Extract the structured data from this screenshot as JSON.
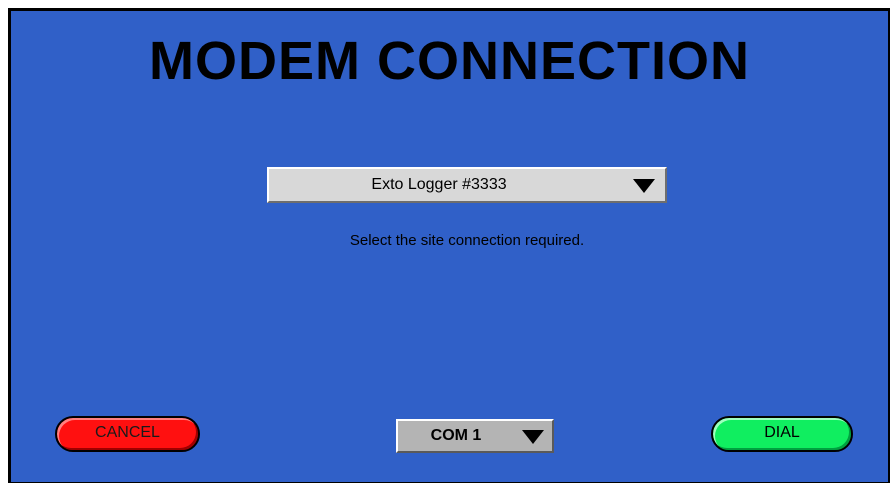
{
  "title": "MODEM CONNECTION",
  "site_select": {
    "selected": "Exto Logger #3333",
    "icon": "chevron-down-icon",
    "hint": "Select the site connection required."
  },
  "buttons": {
    "cancel_label": "CANCEL",
    "dial_label": "DIAL"
  },
  "port_select": {
    "selected": "COM 1",
    "icon": "chevron-down-icon"
  },
  "colors": {
    "background": "#3060c8",
    "cancel": "#ff1010",
    "dial": "#10ee60",
    "dropdown": "#d8d8d8",
    "port": "#b4b4b4"
  }
}
